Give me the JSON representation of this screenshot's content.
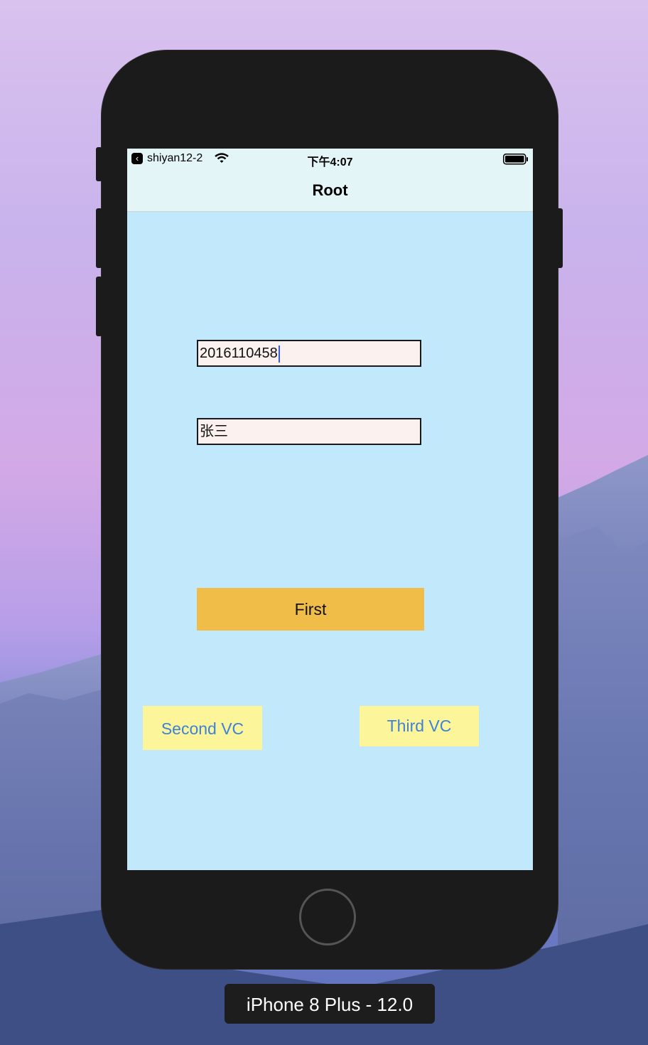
{
  "status_bar": {
    "back_app": "shiyan12-2",
    "time": "下午4:07",
    "icons": [
      "back-arrow-icon",
      "wifi-icon",
      "battery-icon"
    ]
  },
  "nav_bar": {
    "title": "Root"
  },
  "form": {
    "id_field_value": "2016110458",
    "name_field_value": "张三"
  },
  "buttons": {
    "first_label": "First",
    "second_vc_label": "Second VC",
    "third_vc_label": "Third VC"
  },
  "simulator": {
    "device_label": "iPhone 8 Plus - 12.0"
  },
  "colors": {
    "screen_background": "#c2e8fb",
    "nav_bar_background": "#e4f5f8",
    "first_button": "#f0bd48",
    "vc_button": "#fdf59a",
    "vc_button_text": "#3d82d8",
    "text_field_background": "#fbf1ee"
  }
}
